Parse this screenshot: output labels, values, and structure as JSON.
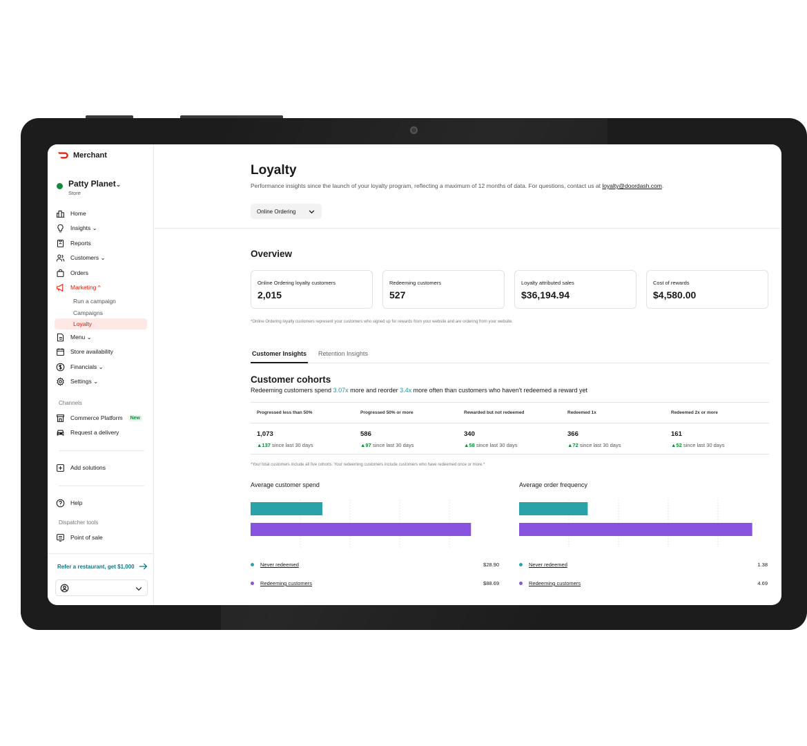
{
  "app": {
    "brand": "Merchant"
  },
  "store": {
    "name": "Patty Planet",
    "chevron": "⌄",
    "type": "Store"
  },
  "sidebar": {
    "items": [
      {
        "label": "Home",
        "icon": "store-icon"
      },
      {
        "label": "Insights ⌄",
        "icon": "lightbulb-icon"
      },
      {
        "label": "Reports",
        "icon": "report-icon"
      },
      {
        "label": "Customers ⌄",
        "icon": "customers-icon"
      },
      {
        "label": "Orders",
        "icon": "bag-icon"
      },
      {
        "label": "Marketing ^",
        "icon": "megaphone-icon"
      }
    ],
    "marketing_sub": [
      "Run a campaign",
      "Campaigns",
      "Loyalty"
    ],
    "items2": [
      {
        "label": "Menu ⌄",
        "icon": "menu-doc-icon"
      },
      {
        "label": "Store availability",
        "icon": "calendar-icon"
      },
      {
        "label": "Financials ⌄",
        "icon": "dollar-icon"
      },
      {
        "label": "Settings ⌄",
        "icon": "gear-icon"
      }
    ],
    "channels_label": "Channels",
    "commerce": "Commerce Platform",
    "commerce_badge": "New",
    "request_delivery": "Request a delivery",
    "add_solutions": "Add solutions",
    "help": "Help",
    "dispatcher_label": "Dispatcher tools",
    "point_of_sale": "Point of sale",
    "refer": "Refer a restaurant, get $1,000"
  },
  "page": {
    "title": "Loyalty",
    "subtitle": "Performance insights since the launch of your loyalty program, reflecting a maximum of 12 months of data. For questions, contact us at ",
    "email": "loyalty@doordash.com",
    "subtitle_end": ".",
    "dropdown": "Online Ordering"
  },
  "overview": {
    "title": "Overview",
    "kpis": [
      {
        "label": "Online Ordering loyalty customers",
        "value": "2,015"
      },
      {
        "label": "Redeeming customers",
        "value": "527"
      },
      {
        "label": "Loyalty attributed sales",
        "value": "$36,194.94"
      },
      {
        "label": "Cost of rewards",
        "value": "$4,580.00"
      }
    ],
    "footnote": "*Online Ordering loyalty customers represent your customers who signed up for rewards from your website and are ordering from your website."
  },
  "tabs": [
    "Customer Insights",
    "Retention Insights"
  ],
  "cohorts": {
    "title": "Customer cohorts",
    "desc_a": "Redeeming customers spend ",
    "desc_hl1": "3.07x",
    "desc_b": " more and reorder ",
    "desc_hl2": "3.4x",
    "desc_c": " more often than customers who haven't redeemed a reward yet",
    "since": "since last 30 days",
    "columns": [
      {
        "header": "Progressed less than 50%",
        "value": "1,073",
        "delta": "▲137"
      },
      {
        "header": "Progressed 50% or more",
        "value": "586",
        "delta": "▲97"
      },
      {
        "header": "Rewarded but not redeemed",
        "value": "340",
        "delta": "▲58"
      },
      {
        "header": "Redeemed 1x",
        "value": "366",
        "delta": "▲72"
      },
      {
        "header": "Redeemed 2x or more",
        "value": "161",
        "delta": "▲52"
      }
    ],
    "footnote": "*Your total customers include all five cohorts. Your redeeming customers include customers who have redeemed once or more.*"
  },
  "colors": {
    "never": "#2aa3a8",
    "redeeming": "#8752dd",
    "accent": "#eb1700",
    "positive": "#138a3b"
  },
  "chart_data": [
    {
      "type": "bar",
      "title": "Average customer spend",
      "categories": [
        "Never redeemed",
        "Redeeming customers"
      ],
      "values": [
        28.9,
        88.69
      ],
      "labels": [
        "$28.90",
        "$88.69"
      ],
      "xlim": [
        0,
        100
      ]
    },
    {
      "type": "bar",
      "title": "Average order frequency",
      "categories": [
        "Never redeemed",
        "Redeeming customers"
      ],
      "values": [
        1.38,
        4.69
      ],
      "labels": [
        "1.38",
        "4.69"
      ],
      "xlim": [
        0,
        5
      ]
    }
  ]
}
